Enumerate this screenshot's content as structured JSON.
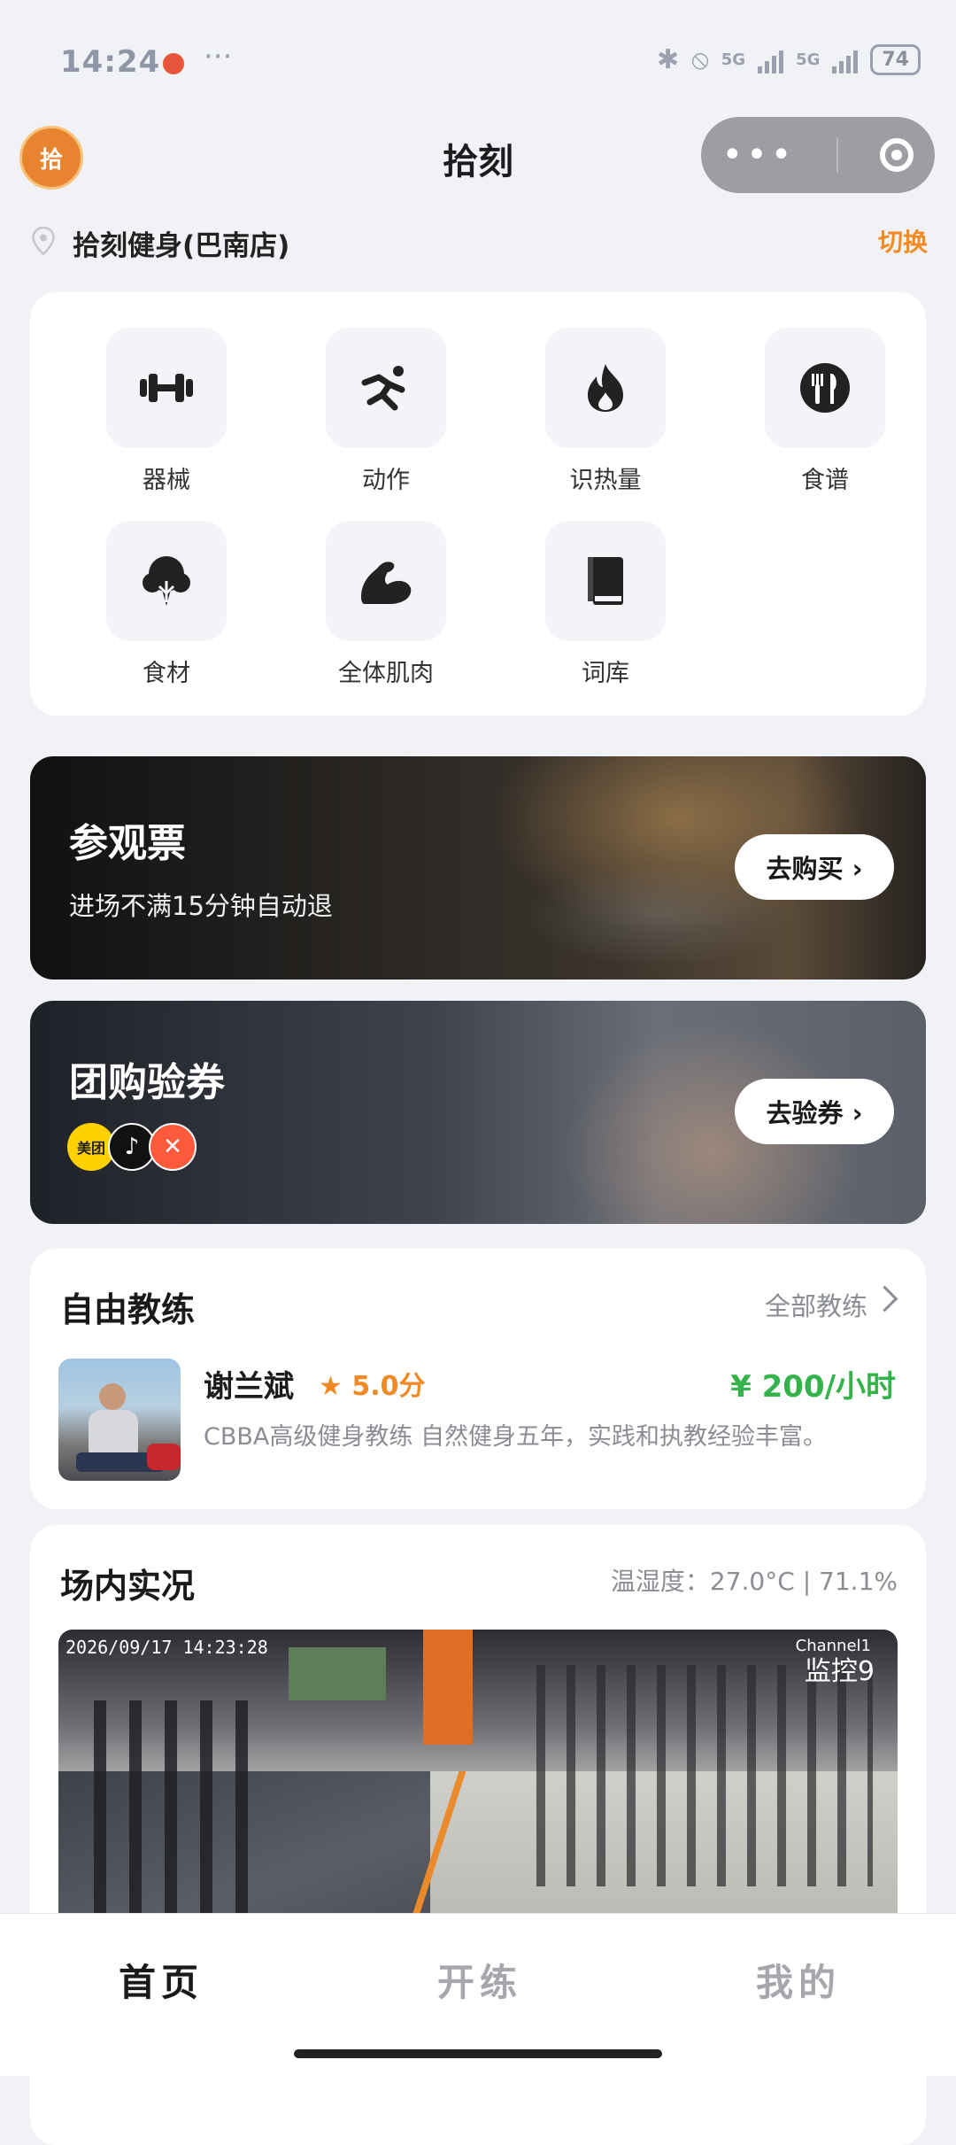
{
  "status_bar": {
    "time": "14:24",
    "extra": "···",
    "network1": "5G",
    "network2": "5G",
    "battery": "74"
  },
  "header": {
    "title": "拾刻",
    "logo_text": "拾"
  },
  "location": {
    "name": "拾刻健身(巴南店)",
    "switch_label": "切换"
  },
  "grid": [
    {
      "label": "器械",
      "icon": "dumbbell-icon"
    },
    {
      "label": "动作",
      "icon": "running-icon"
    },
    {
      "label": "识热量",
      "icon": "flame-icon"
    },
    {
      "label": "食谱",
      "icon": "cutlery-icon"
    },
    {
      "label": "食材",
      "icon": "broccoli-icon"
    },
    {
      "label": "全体肌肉",
      "icon": "muscle-icon"
    },
    {
      "label": "词库",
      "icon": "book-icon"
    }
  ],
  "banners": {
    "ticket": {
      "title": "参观票",
      "subtitle": "进场不满15分钟自动退",
      "button": "去购买 ›"
    },
    "groupon": {
      "title": "团购验券",
      "button": "去验券 ›",
      "badge_meituan": "美团"
    }
  },
  "coach_section": {
    "title": "自由教练",
    "more": "全部教练",
    "coach": {
      "name": "谢兰斌",
      "rating": "5.0分",
      "price": "¥ 200/小时",
      "desc": "CBBA高级健身教练 自然健身五年，实践和执教经验丰富。"
    }
  },
  "live_section": {
    "title": "场内实况",
    "env": "温湿度：27.0°C | 71.1%",
    "camera": {
      "timestamp": "2026/09/17 14:23:28",
      "channel": "Channel1",
      "label": "监控9"
    }
  },
  "tabs": [
    {
      "label": "首页",
      "active": true
    },
    {
      "label": "开练",
      "active": false
    },
    {
      "label": "我的",
      "active": false
    }
  ],
  "colors": {
    "accent": "#f08a24",
    "price": "#34b34a",
    "background": "#f1f2f6"
  }
}
